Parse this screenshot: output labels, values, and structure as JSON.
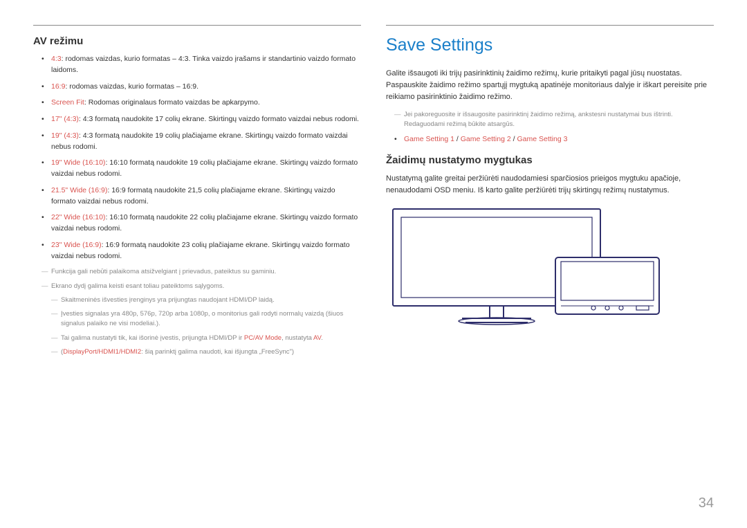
{
  "pageNumber": "34",
  "left": {
    "heading": "AV režimu",
    "bullets": [
      {
        "label": "4:3",
        "text": ": rodomas vaizdas, kurio formatas – 4:3. Tinka vaizdo įrašams ir standartinio vaizdo formato laidoms."
      },
      {
        "label": "16:9",
        "text": ": rodomas vaizdas, kurio formatas – 16:9."
      },
      {
        "label": "Screen Fit",
        "text": ": Rodomas originalaus formato vaizdas be apkarpymo."
      },
      {
        "label": "17\" (4:3)",
        "text": ": 4:3 formatą naudokite 17 colių ekrane. Skirtingų vaizdo formato vaizdai nebus rodomi."
      },
      {
        "label": "19\" (4:3)",
        "text": ": 4:3 formatą naudokite 19 colių plačiajame ekrane. Skirtingų vaizdo formato vaizdai nebus rodomi."
      },
      {
        "label": "19\" Wide (16:10)",
        "text": ": 16:10 formatą naudokite 19 colių plačiajame ekrane. Skirtingų vaizdo formato vaizdai nebus rodomi."
      },
      {
        "label": "21.5\" Wide (16:9)",
        "text": ": 16:9 formatą naudokite 21,5 colių plačiajame ekrane. Skirtingų vaizdo formato vaizdai nebus rodomi."
      },
      {
        "label": "22\" Wide (16:10)",
        "text": ": 16:10 formatą naudokite 22 colių plačiajame ekrane. Skirtingų vaizdo formato vaizdai nebus rodomi."
      },
      {
        "label": "23\" Wide (16:9)",
        "text": ": 16:9 formatą naudokite 23 colių plačiajame ekrane. Skirtingų vaizdo formato vaizdai nebus rodomi."
      }
    ],
    "notes": {
      "n1": "Funkcija gali nebūti palaikoma atsižvelgiant į prievadus, pateiktus su gaminiu.",
      "n2": "Ekrano dydį galima keisti esant toliau pateiktoms sąlygoms.",
      "n2a": "Skaitmeninės išvesties įrenginys yra prijungtas naudojant HDMI/DP laidą.",
      "n2b": "Įvesties signalas yra 480p, 576p, 720p arba 1080p, o monitorius gali rodyti normalų vaizdą (šiuos signalus palaiko ne visi modeliai.).",
      "n2c_pre": "Tai galima nustatyti tik, kai išorinė įvestis, prijungta HDMI/DP ir ",
      "n2c_hl1": "PC/AV Mode",
      "n2c_mid": ", nustatyta ",
      "n2c_hl2": "AV",
      "n2c_end": ".",
      "n2d_pre": "(",
      "n2d_hl": "DisplayPort/HDMI1/HDMI2",
      "n2d_end": ": šią parinktį galima naudoti, kai išjungta „FreeSync\")"
    }
  },
  "right": {
    "title": "Save Settings",
    "para1": "Galite išsaugoti iki trijų pasirinktinių žaidimo režimų, kurie pritaikyti pagal jūsų nuostatas. Paspauskite žaidimo režimo spartųjį mygtuką apatinėje monitoriaus dalyje ir iškart pereisite prie reikiamo pasirinktinio žaidimo režimo.",
    "note1": "Jei pakoreguosite ir išsaugosite pasirinktinį žaidimo režimą, ankstesni nustatymai bus ištrinti. Redaguodami režimą būkite atsargūs.",
    "gs1": "Game Setting 1",
    "gs2": "Game Setting 2",
    "gs3": "Game Setting 3",
    "slash": " / ",
    "heading2": "Žaidimų nustatymo mygtukas",
    "para2": "Nustatymą galite greitai peržiūrėti naudodamiesi sparčiosios prieigos mygtuku apačioje, nenaudodami OSD meniu. Iš karto galite peržiūrėti trijų skirtingų režimų nustatymus."
  }
}
